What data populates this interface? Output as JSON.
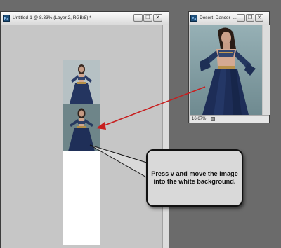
{
  "main_window": {
    "title": "Untitled-1 @ 8.33% (Layer 2, RGB/8) *",
    "app_badge": "Ps"
  },
  "desert_window": {
    "title": "Desert_Dancer_...",
    "app_badge": "Ps",
    "zoom": "16.67%"
  },
  "window_controls": {
    "minimize": "–",
    "restore": "❐",
    "close": "✕"
  },
  "callout": {
    "text": "Press v and move the image into the white background."
  },
  "colors": {
    "app_background": "#6b6b6b",
    "document_background": "#c6c6c6",
    "arrow_red": "#c81e1e",
    "callout_fill": "#d9d9d9"
  }
}
